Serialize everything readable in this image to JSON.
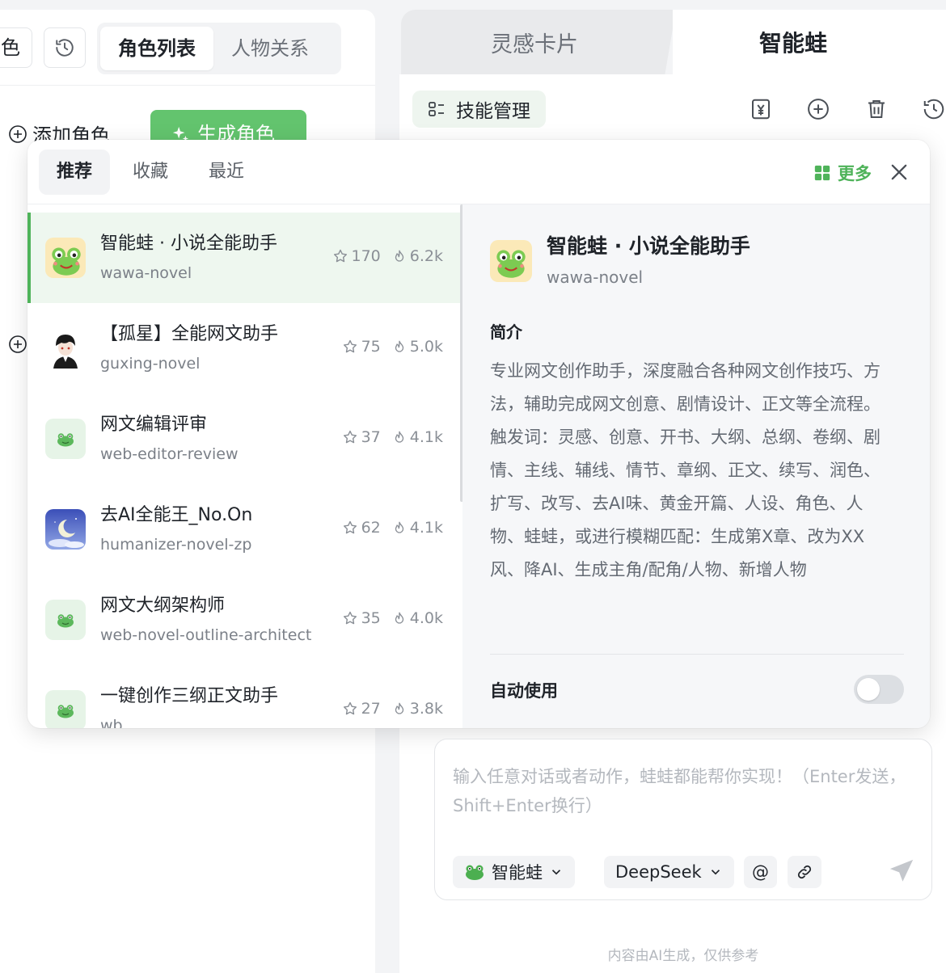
{
  "left": {
    "role_button_partial": "色",
    "segments": [
      "角色列表",
      "人物关系"
    ],
    "add_role": "添加角色",
    "gen_role": "生成角色"
  },
  "header_tabs": {
    "cards": "灵感卡片",
    "wawa": "智能蛙"
  },
  "skill_manage": "技能管理",
  "popup": {
    "tabs": [
      "推荐",
      "收藏",
      "最近"
    ],
    "more": "更多",
    "items": [
      {
        "title": "智能蛙 · 小说全能助手",
        "slug": "wawa-novel",
        "stars": "170",
        "heat": "6.2k",
        "avatar": "frog-cartoon-avatar"
      },
      {
        "title": "【孤星】全能网文助手",
        "slug": "guxing-novel",
        "stars": "75",
        "heat": "5.0k",
        "avatar": "anime-boy-avatar"
      },
      {
        "title": "网文编辑评审",
        "slug": "web-editor-review",
        "stars": "37",
        "heat": "4.1k",
        "avatar": "frog-emoji-avatar"
      },
      {
        "title": "去AI全能王_No.On",
        "slug": "humanizer-novel-zp",
        "stars": "62",
        "heat": "4.1k",
        "avatar": "moon-night-avatar"
      },
      {
        "title": "网文大纲架构师",
        "slug": "web-novel-outline-architect",
        "stars": "35",
        "heat": "4.0k",
        "avatar": "frog-emoji-avatar"
      },
      {
        "title": "一键创作三纲正文助手",
        "slug": "wb",
        "stars": "27",
        "heat": "3.8k",
        "avatar": "frog-emoji-avatar"
      }
    ],
    "detail": {
      "title": "智能蛙 · 小说全能助手",
      "slug": "wawa-novel",
      "intro_label": "简介",
      "intro": "专业网文创作助手，深度融合各种网文创作技巧、方法，辅助完成网文创意、剧情设计、正文等全流程。触发词：灵感、创意、开书、大纲、总纲、卷纲、剧情、主线、辅线、情节、章纲、正文、续写、润色、扩写、改写、去AI味、黄金开篇、人设、角色、人物、蛙蛙，或进行模糊匹配：生成第X章、改为XX风、降AI、生成主角/配角/人物、新增人物",
      "auto_use": "自动使用",
      "auto_use_enabled": false
    }
  },
  "input": {
    "placeholder": "输入任意对话或者动作，蛙蛙都能帮你实现！（Enter发送，Shift+Enter换行）",
    "agent": "智能蛙",
    "model": "DeepSeek",
    "at": "@"
  },
  "disclaimer": "内容由AI生成，仅供参考",
  "colors": {
    "accent": "#4fb35a",
    "selected_bg": "#eef7ef",
    "gen_button": "#63c46e"
  }
}
